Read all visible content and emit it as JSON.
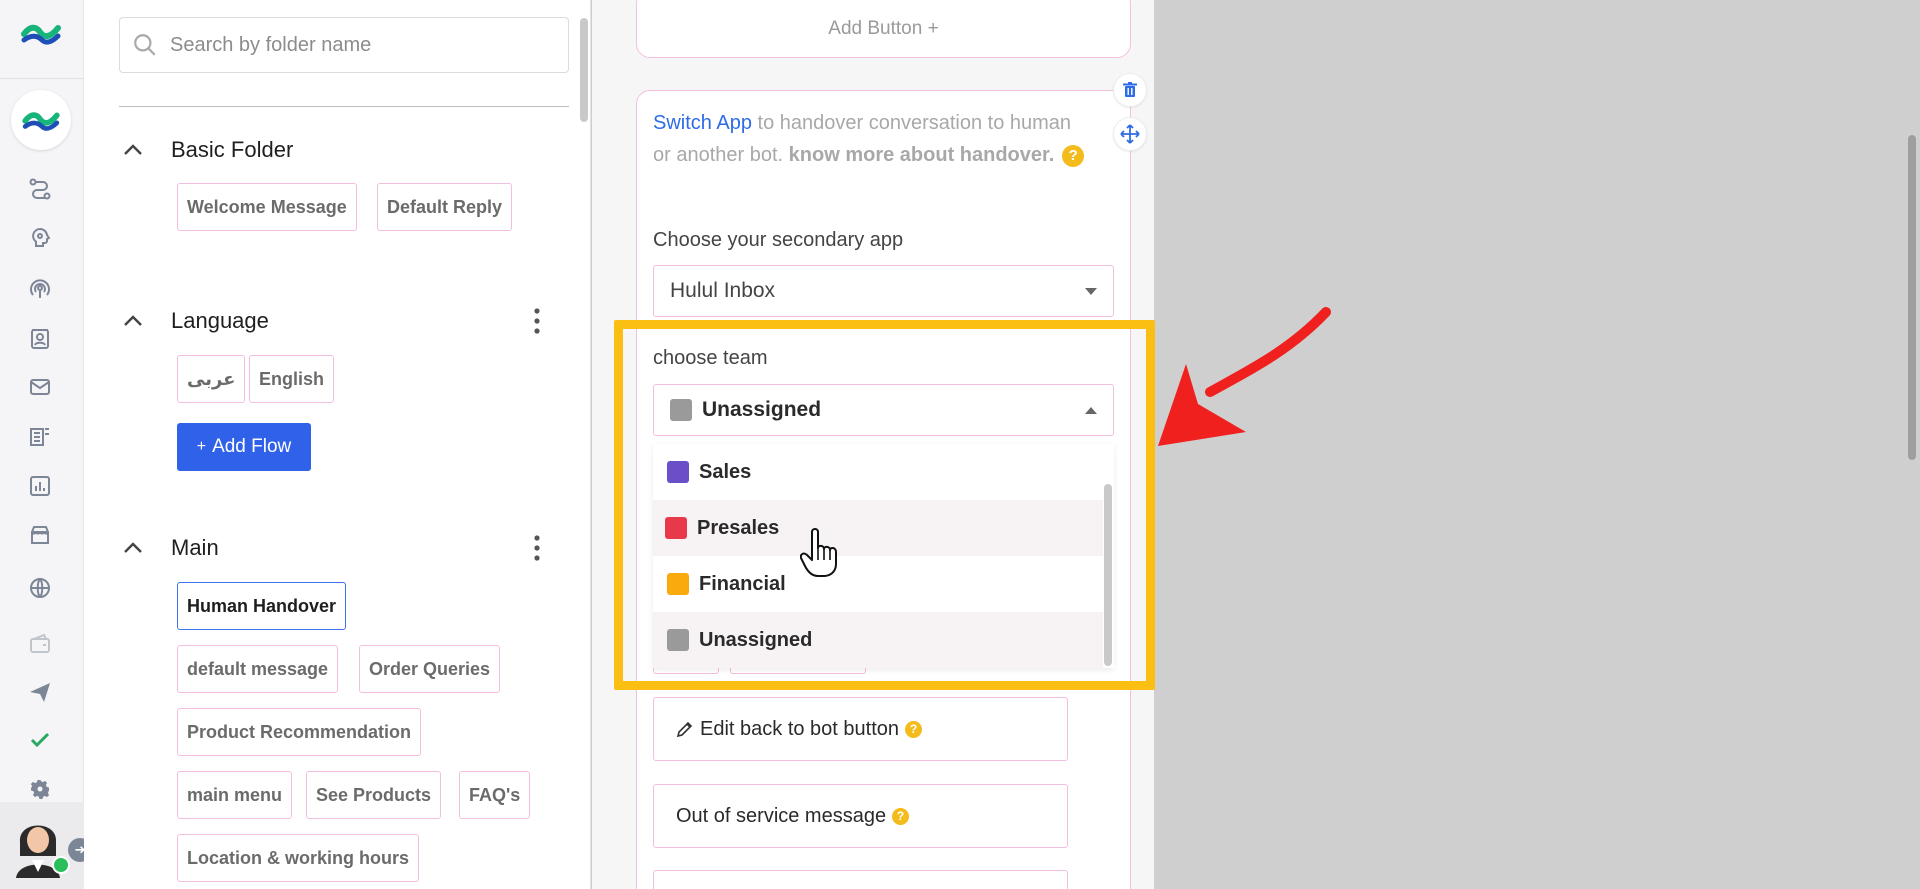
{
  "search": {
    "placeholder": "Search by folder name"
  },
  "folders": [
    {
      "title": "Basic Folder",
      "items": [
        "Welcome Message",
        "Default Reply"
      ]
    },
    {
      "title": "Language",
      "items": [
        "عربى",
        "English"
      ],
      "add_flow_label": "Add Flow"
    },
    {
      "title": "Main",
      "items": [
        "Human Handover",
        "default message",
        "Order Queries",
        "Product Recommendation",
        "main menu",
        "See Products",
        "FAQ's",
        "Location & working hours"
      ]
    }
  ],
  "canvas": {
    "add_button_label": "Add Button +",
    "handover": {
      "link_text": "Switch App",
      "desc_text": " to handover conversation to human or another bot. ",
      "bold_text": "know more about handover.",
      "secondary_app_label": "Choose your secondary app",
      "secondary_app_value": "Hulul Inbox",
      "team_label": "choose team",
      "team_selected": "Unassigned",
      "team_options": [
        {
          "label": "Sales",
          "color": "#6a4fc9"
        },
        {
          "label": "Presales",
          "color": "#e8394a"
        },
        {
          "label": "Financial",
          "color": "#fbaa0d"
        },
        {
          "label": "Unassigned",
          "color": "#9a9a9a"
        }
      ],
      "team_selected_color": "#9a9a9a",
      "edit_back_label": "Edit back to bot button",
      "out_of_service_label": "Out of service message"
    }
  },
  "colors": {
    "accent": "#2f62e8",
    "highlight": "#fbbf14",
    "annotation_arrow": "#f0201e"
  }
}
